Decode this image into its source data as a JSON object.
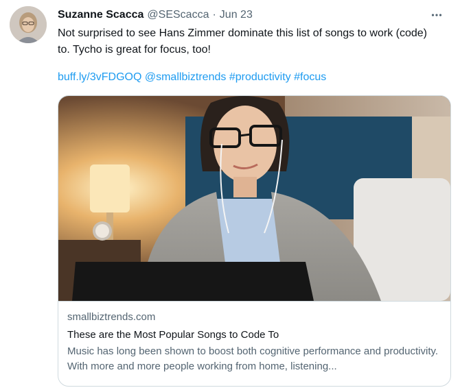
{
  "tweet": {
    "author": {
      "display_name": "Suzanne Scacca",
      "handle": "@SEScacca"
    },
    "separator": "·",
    "date": "Jun 23",
    "more_icon": "more-horizontal-icon",
    "text_line_1": "Not surprised to see Hans Zimmer dominate this list of songs to work (code)",
    "text_line_2": "to. Tycho is great for focus, too!",
    "links": [
      "buff.ly/3vFDGOQ",
      "@smallbiztrends",
      "#productivity",
      "#focus"
    ],
    "link_color": "#1d9bf0"
  },
  "card": {
    "domain": "smallbiztrends.com",
    "title": "These are the Most Popular Songs to Code To",
    "description": "Music has long been shown to boost both cognitive performance and productivity. With more and more people working from home, listening..."
  }
}
